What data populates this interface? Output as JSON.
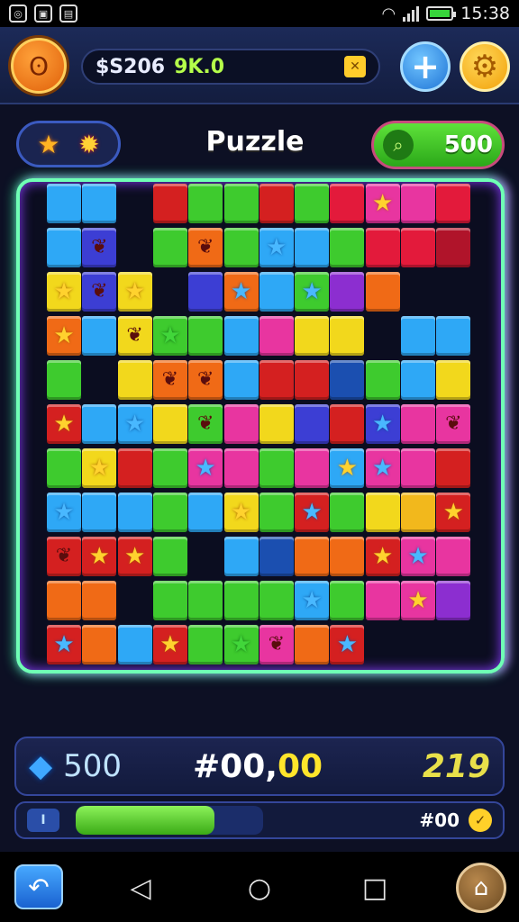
{
  "status": {
    "time": "15:38",
    "left_icons": [
      "app-icon",
      "image-icon",
      "gallery-icon"
    ],
    "battery_color": "#37d43b"
  },
  "top_bar": {
    "currency_text": "$S206",
    "currency_accent": "9K.0",
    "chip_glyph": "✕",
    "avatar_icon": "monkey-face-icon",
    "plus_label": "+",
    "settings_icon": "gear-icon"
  },
  "header": {
    "title": "Puzzle",
    "score": "500",
    "score_icon": "search-icon"
  },
  "board": {
    "cols": 12,
    "rows": 11,
    "cells": [
      [
        "#2ea8f6",
        "#2ea8f6",
        "",
        "#d42020",
        "#3ecb2e",
        "#3ecb2e",
        "#d42020",
        "#3ecb2e",
        "#e31a3b",
        "#e835a0",
        "#e835a0",
        "#e31a3b"
      ],
      [
        "#2ea8f6",
        "#3c3ed4",
        "",
        "#3ecb2e",
        "#f06a16",
        "#3ecb2e",
        "#2ea8f6",
        "#2ea8f6",
        "#3ecb2e",
        "#e31a3b",
        "#e31a3b",
        "#b0142a"
      ],
      [
        "#f2d81c",
        "#3c3ed4",
        "#f2d81c",
        "",
        "#3c3ed4",
        "#f06a16",
        "#2ea8f6",
        "#3ecb2e",
        "#8c2ed0",
        "#f06a16",
        "",
        ""
      ],
      [
        "#f06a16",
        "#2ea8f6",
        "#f2d81c",
        "#3ecb2e",
        "#3ecb2e",
        "#2ea8f6",
        "#e835a0",
        "#f2d81c",
        "#f2d81c",
        "",
        "#2ea8f6",
        "#2ea8f6"
      ],
      [
        "#3ecb2e",
        "",
        "#f2d81c",
        "#f06a16",
        "#f06a16",
        "#2ea8f6",
        "#d42020",
        "#d42020",
        "#1b4fb0",
        "#3ecb2e",
        "#2ea8f6",
        "#f2d81c"
      ],
      [
        "#d42020",
        "#2ea8f6",
        "#2ea8f6",
        "#f2d81c",
        "#3ecb2e",
        "#e835a0",
        "#f2d81c",
        "#3c3ed4",
        "#d42020",
        "#3c3ed4",
        "#e835a0",
        "#e835a0"
      ],
      [
        "#3ecb2e",
        "#f2d81c",
        "#d42020",
        "#3ecb2e",
        "#e835a0",
        "#e835a0",
        "#3ecb2e",
        "#e835a0",
        "#2ea8f6",
        "#e835a0",
        "#e835a0",
        "#d42020"
      ],
      [
        "#2ea8f6",
        "#2ea8f6",
        "#2ea8f6",
        "#3ecb2e",
        "#2ea8f6",
        "#f2d81c",
        "#3ecb2e",
        "#d42020",
        "#3ecb2e",
        "#f2d81c",
        "#f2b81c",
        "#d42020"
      ],
      [
        "#d42020",
        "#d42020",
        "#d42020",
        "#3ecb2e",
        "",
        "#2ea8f6",
        "#1b4fb0",
        "#f06a16",
        "#f06a16",
        "#d42020",
        "#e835a0",
        "#e835a0"
      ],
      [
        "#f06a16",
        "#f06a16",
        "",
        "#3ecb2e",
        "#3ecb2e",
        "#3ecb2e",
        "#3ecb2e",
        "#2ea8f6",
        "#3ecb2e",
        "#e835a0",
        "#e835a0",
        "#8c2ed0"
      ],
      [
        "#d42020",
        "#f06a16",
        "#2ea8f6",
        "#d42020",
        "#3ecb2e",
        "#3ecb2e",
        "#e835a0",
        "#f06a16",
        "#d42020",
        "",
        "",
        ""
      ]
    ],
    "pieces": [
      {
        "r": 0,
        "c": 9,
        "kind": "star"
      },
      {
        "r": 1,
        "c": 1,
        "kind": "paw"
      },
      {
        "r": 1,
        "c": 4,
        "kind": "paw"
      },
      {
        "r": 1,
        "c": 6,
        "kind": "bstar"
      },
      {
        "r": 2,
        "c": 0,
        "kind": "star"
      },
      {
        "r": 2,
        "c": 1,
        "kind": "paw"
      },
      {
        "r": 2,
        "c": 2,
        "kind": "star"
      },
      {
        "r": 2,
        "c": 5,
        "kind": "bstar"
      },
      {
        "r": 2,
        "c": 7,
        "kind": "bstar"
      },
      {
        "r": 2,
        "c": 10,
        "kind": "star"
      },
      {
        "r": 3,
        "c": 0,
        "kind": "star"
      },
      {
        "r": 3,
        "c": 2,
        "kind": "paw"
      },
      {
        "r": 3,
        "c": 3,
        "kind": "gstar"
      },
      {
        "r": 4,
        "c": 3,
        "kind": "paw"
      },
      {
        "r": 4,
        "c": 4,
        "kind": "paw"
      },
      {
        "r": 5,
        "c": 0,
        "kind": "star"
      },
      {
        "r": 5,
        "c": 2,
        "kind": "bstar"
      },
      {
        "r": 5,
        "c": 4,
        "kind": "paw"
      },
      {
        "r": 5,
        "c": 9,
        "kind": "bstar"
      },
      {
        "r": 5,
        "c": 11,
        "kind": "paw"
      },
      {
        "r": 6,
        "c": 1,
        "kind": "star"
      },
      {
        "r": 6,
        "c": 4,
        "kind": "bstar"
      },
      {
        "r": 6,
        "c": 8,
        "kind": "star"
      },
      {
        "r": 6,
        "c": 9,
        "kind": "bstar"
      },
      {
        "r": 7,
        "c": 0,
        "kind": "bstar"
      },
      {
        "r": 7,
        "c": 5,
        "kind": "star"
      },
      {
        "r": 7,
        "c": 7,
        "kind": "bstar"
      },
      {
        "r": 7,
        "c": 11,
        "kind": "star"
      },
      {
        "r": 8,
        "c": 0,
        "kind": "paw"
      },
      {
        "r": 8,
        "c": 1,
        "kind": "star"
      },
      {
        "r": 8,
        "c": 2,
        "kind": "star"
      },
      {
        "r": 8,
        "c": 9,
        "kind": "star"
      },
      {
        "r": 8,
        "c": 10,
        "kind": "bstar"
      },
      {
        "r": 9,
        "c": 7,
        "kind": "bstar"
      },
      {
        "r": 9,
        "c": 10,
        "kind": "star"
      },
      {
        "r": 10,
        "c": 0,
        "kind": "bstar"
      },
      {
        "r": 10,
        "c": 3,
        "kind": "star"
      },
      {
        "r": 10,
        "c": 5,
        "kind": "gstar"
      },
      {
        "r": 10,
        "c": 6,
        "kind": "paw"
      },
      {
        "r": 10,
        "c": 8,
        "kind": "bstar"
      }
    ]
  },
  "bottom": {
    "gem_value": "500",
    "center_white": "#00,",
    "center_yellow": "00",
    "right_value": "219",
    "progress_label": "#00",
    "progress_fraction": 0.74,
    "progress_icon_text": "I",
    "badge_glyph": "✓"
  },
  "nav": {
    "back_icon": "undo-arrow-icon",
    "home_app_icon": "house-icon"
  }
}
